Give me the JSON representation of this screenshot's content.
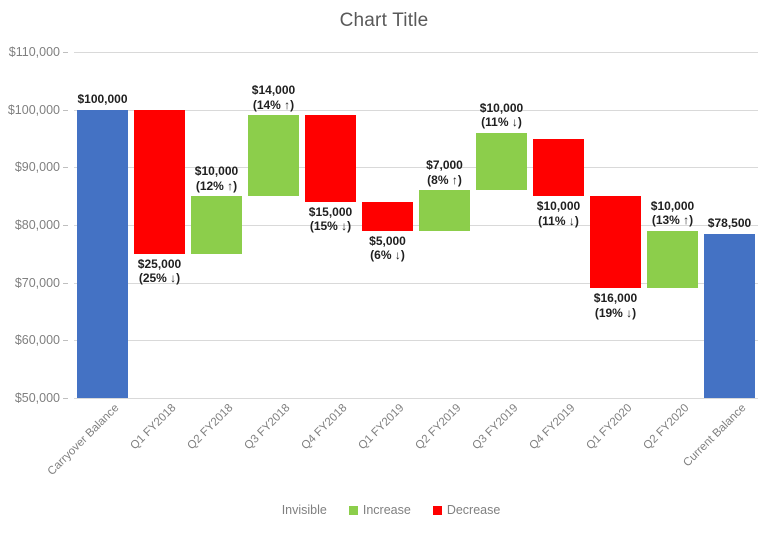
{
  "chart": {
    "title": "Chart Title"
  },
  "legend": {
    "position": "bottom",
    "items": [
      {
        "label": "Invisible",
        "color": "#ffffff",
        "visible_swatch": false
      },
      {
        "label": "Increase",
        "color": "#8CCE4B",
        "visible_swatch": true
      },
      {
        "label": "Decrease",
        "color": "#FF0000",
        "visible_swatch": true
      }
    ]
  },
  "colors": {
    "total": "#4472C4",
    "increase": "#8CCE4B",
    "decrease": "#FF0000",
    "gridline": "#D9D9D9",
    "axis_text": "#808080",
    "title_text": "#595959",
    "label_text": "#202020"
  },
  "axis": {
    "y_ticks": [
      "$110,000",
      "$100,000",
      "$90,000",
      "$80,000",
      "$70,000",
      "$60,000",
      "$50,000"
    ],
    "y_tick_values": [
      110000,
      100000,
      90000,
      80000,
      70000,
      60000,
      50000
    ],
    "ylim": [
      50000,
      110000
    ],
    "y_major_step": 10000,
    "grid": true,
    "x_labels": [
      "Carryover Balance",
      "Q1 FY2018",
      "Q2 FY2018",
      "Q3 FY2018",
      "Q4 FY2018",
      "Q1 FY2019",
      "Q2 FY2019",
      "Q3 FY2019",
      "Q4 FY2019",
      "Q1 FY2020",
      "Q2 FY2020",
      "Current Balance"
    ]
  },
  "chart_data": {
    "type": "bar",
    "subtype": "waterfall",
    "title": "Chart Title",
    "xlabel": "",
    "ylabel": "",
    "ylim": [
      50000,
      110000
    ],
    "grid": true,
    "legend_position": "bottom",
    "categories": [
      "Carryover Balance",
      "Q1 FY2018",
      "Q2 FY2018",
      "Q3 FY2018",
      "Q4 FY2018",
      "Q1 FY2019",
      "Q2 FY2019",
      "Q3 FY2019",
      "Q4 FY2019",
      "Q1 FY2020",
      "Q2 FY2020",
      "Current Balance"
    ],
    "bars": [
      {
        "category": "Carryover Balance",
        "kind": "total",
        "delta": 0,
        "base": 50000,
        "top": 100000,
        "label_value": "$100,000",
        "label_pct": "",
        "label_position": "above"
      },
      {
        "category": "Q1 FY2018",
        "kind": "decrease",
        "delta": -25000,
        "base": 75000,
        "top": 100000,
        "label_value": "$25,000",
        "label_pct": "(25% ↓)",
        "label_position": "below"
      },
      {
        "category": "Q2 FY2018",
        "kind": "increase",
        "delta": 10000,
        "base": 75000,
        "top": 85000,
        "label_value": "$10,000",
        "label_pct": "(12% ↑)",
        "label_position": "above"
      },
      {
        "category": "Q3 FY2018",
        "kind": "increase",
        "delta": 14000,
        "base": 85000,
        "top": 99000,
        "label_value": "$14,000",
        "label_pct": "(14% ↑)",
        "label_position": "above"
      },
      {
        "category": "Q4 FY2018",
        "kind": "decrease",
        "delta": -15000,
        "base": 84000,
        "top": 99000,
        "label_value": "$15,000",
        "label_pct": "(15% ↓)",
        "label_position": "below"
      },
      {
        "category": "Q1 FY2019",
        "kind": "decrease",
        "delta": -5000,
        "base": 79000,
        "top": 84000,
        "label_value": "$5,000",
        "label_pct": "(6% ↓)",
        "label_position": "below"
      },
      {
        "category": "Q2 FY2019",
        "kind": "increase",
        "delta": 7000,
        "base": 79000,
        "top": 86000,
        "label_value": "$7,000",
        "label_pct": "(8% ↑)",
        "label_position": "above"
      },
      {
        "category": "Q3 FY2019",
        "kind": "increase",
        "delta": 10000,
        "base": 86000,
        "top": 96000,
        "label_value": "$10,000",
        "label_pct": "(11% ↓)",
        "label_position": "above"
      },
      {
        "category": "Q4 FY2019",
        "kind": "decrease",
        "delta": -10000,
        "base": 85000,
        "top": 95000,
        "label_value": "$10,000",
        "label_pct": "(11% ↓)",
        "label_position": "below"
      },
      {
        "category": "Q1 FY2020",
        "kind": "decrease",
        "delta": -16000,
        "base": 69000,
        "top": 85000,
        "label_value": "$16,000",
        "label_pct": "(19% ↓)",
        "label_position": "below"
      },
      {
        "category": "Q2 FY2020",
        "kind": "increase",
        "delta": 10000,
        "base": 69000,
        "top": 79000,
        "label_value": "$10,000",
        "label_pct": "(13% ↑)",
        "label_position": "above"
      },
      {
        "category": "Current Balance",
        "kind": "total",
        "delta": 0,
        "base": 50000,
        "top": 78500,
        "label_value": "$78,500",
        "label_pct": "",
        "label_position": "above"
      }
    ]
  }
}
